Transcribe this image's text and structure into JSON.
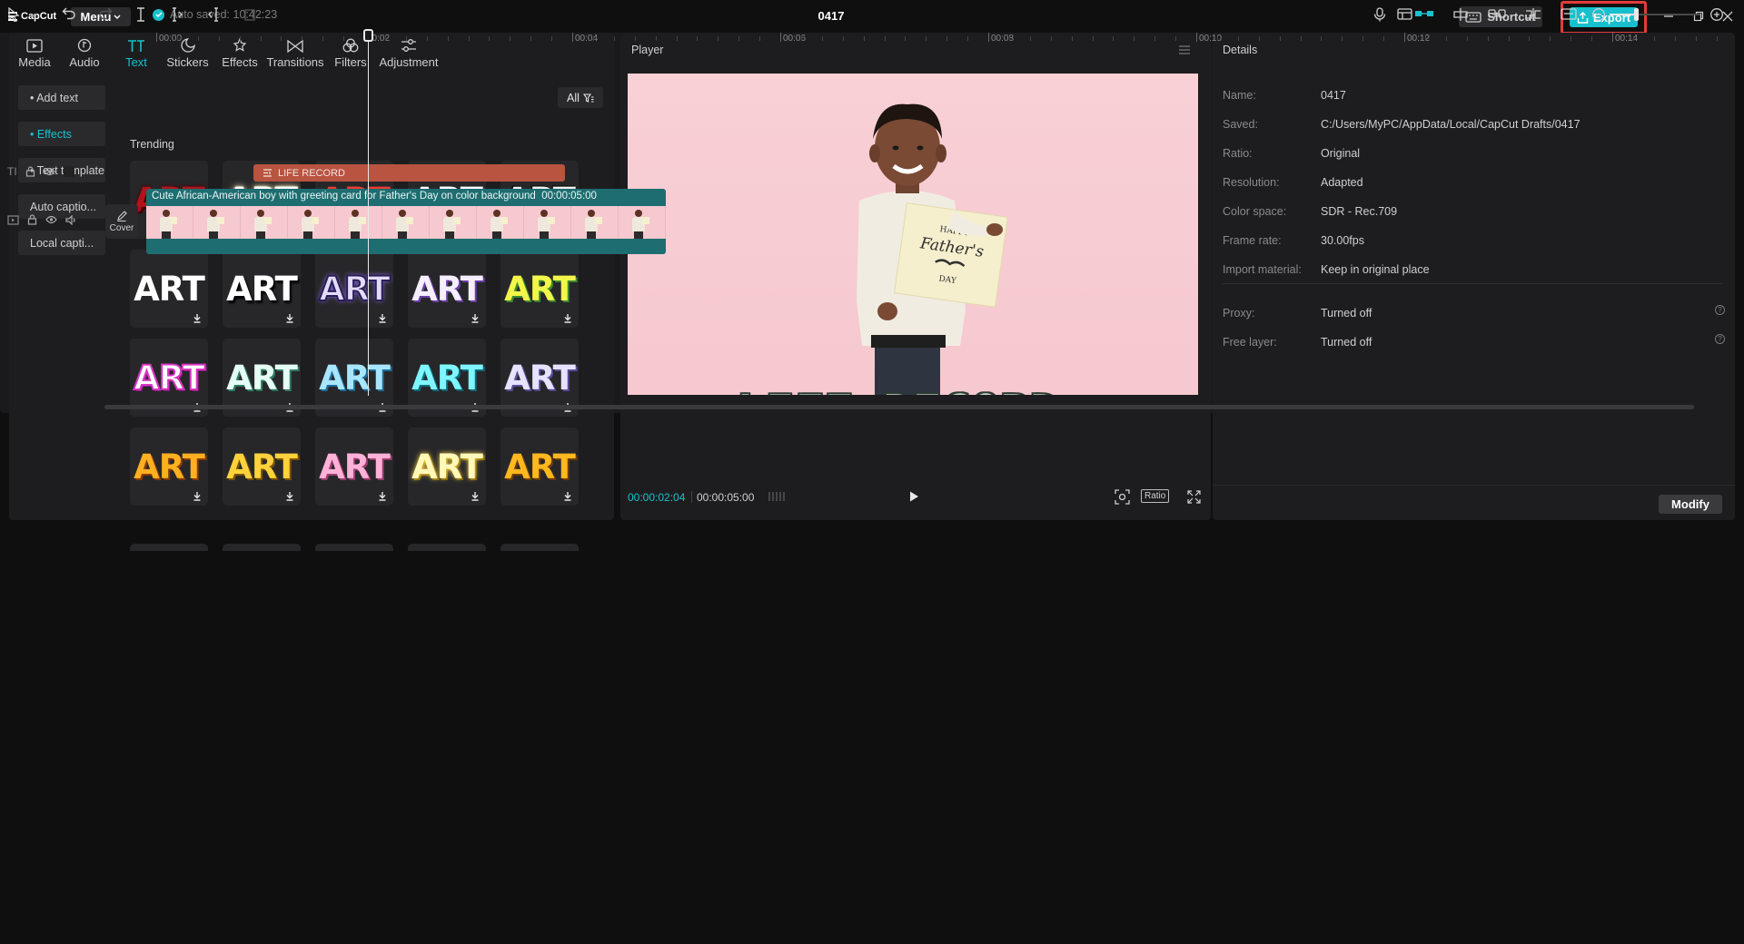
{
  "app": {
    "logo_text": "CapCut",
    "menu_label": "Menu",
    "autosave": "Auto saved: 10:42:23",
    "project_title": "0417",
    "shortcut_label": "Shortcut",
    "export_label": "Export"
  },
  "categories": [
    {
      "label": "Media",
      "icon": "media-icon"
    },
    {
      "label": "Audio",
      "icon": "audio-icon"
    },
    {
      "label": "Text",
      "icon": "text-icon",
      "active": true
    },
    {
      "label": "Stickers",
      "icon": "stickers-icon"
    },
    {
      "label": "Effects",
      "icon": "effects-icon"
    },
    {
      "label": "Transitions",
      "icon": "transitions-icon"
    },
    {
      "label": "Filters",
      "icon": "filters-icon"
    },
    {
      "label": "Adjustment",
      "icon": "adjustment-icon"
    }
  ],
  "side_nav": [
    {
      "label": "• Add text"
    },
    {
      "label": "• Effects",
      "active": true
    },
    {
      "label": "• Text template"
    },
    {
      "label": "Auto captio..."
    },
    {
      "label": "Local capti..."
    }
  ],
  "filter_label": "All",
  "trending_label": "Trending",
  "art_tiles": [
    {
      "text": "ART",
      "style": "red-dark"
    },
    {
      "text": "ART",
      "style": "white-glow"
    },
    {
      "text": "ART",
      "style": "red-bright"
    },
    {
      "text": "ART",
      "style": "white-purple"
    },
    {
      "text": "ART",
      "style": "white-black"
    },
    {
      "text": "ART",
      "style": "white-plain"
    },
    {
      "text": "ART",
      "style": "white-shadow"
    },
    {
      "text": "ART",
      "style": "navy-outline"
    },
    {
      "text": "ART",
      "style": "white-violet"
    },
    {
      "text": "ART",
      "style": "yellow-green"
    },
    {
      "text": "ART",
      "style": "pink-white"
    },
    {
      "text": "ART",
      "style": "mint"
    },
    {
      "text": "ART",
      "style": "sky-blue"
    },
    {
      "text": "ART",
      "style": "cyan"
    },
    {
      "text": "ART",
      "style": "lavender"
    },
    {
      "text": "ART",
      "style": "orange"
    },
    {
      "text": "ART",
      "style": "gold"
    },
    {
      "text": "ART",
      "style": "pink-pastel"
    },
    {
      "text": "ART",
      "style": "cream-yellow"
    },
    {
      "text": "ART",
      "style": "amber"
    }
  ],
  "player": {
    "title": "Player",
    "current_time": "00:00:02:04",
    "total_time": "00:00:05:00",
    "ratio_label": "Ratio",
    "video_overlay_text": "LIFE RECORD",
    "card_line1": "HAPPY",
    "card_line2": "Father's",
    "card_line3": "DAY"
  },
  "details": {
    "title": "Details",
    "rows": [
      {
        "label": "Name:",
        "value": "0417"
      },
      {
        "label": "Saved:",
        "value": "C:/Users/MyPC/AppData/Local/CapCut Drafts/0417"
      },
      {
        "label": "Ratio:",
        "value": "Original"
      },
      {
        "label": "Resolution:",
        "value": "Adapted"
      },
      {
        "label": "Color space:",
        "value": "SDR - Rec.709"
      },
      {
        "label": "Frame rate:",
        "value": "30.00fps"
      },
      {
        "label": "Import material:",
        "value": "Keep in original place"
      }
    ],
    "extra_rows": [
      {
        "label": "Proxy:",
        "value": "Turned off"
      },
      {
        "label": "Free layer:",
        "value": "Turned off"
      }
    ],
    "modify_label": "Modify"
  },
  "timeline": {
    "ticks": [
      "00:00",
      "00:02",
      "00:04",
      "00:06",
      "00:08",
      "00:10",
      "00:12",
      "00:14"
    ],
    "text_clip_label": "LIFE RECORD",
    "video_clip_label": "Cute African-American boy with greeting card for Father's Day on color background",
    "video_clip_duration": "00:00:05:00",
    "cover_label": "Cover",
    "frame_count": 11
  },
  "colors": {
    "accent": "#19c1cc",
    "export_highlight": "#e23b3b",
    "text_clip": "#b85440",
    "video_clip": "#1e6d70"
  }
}
